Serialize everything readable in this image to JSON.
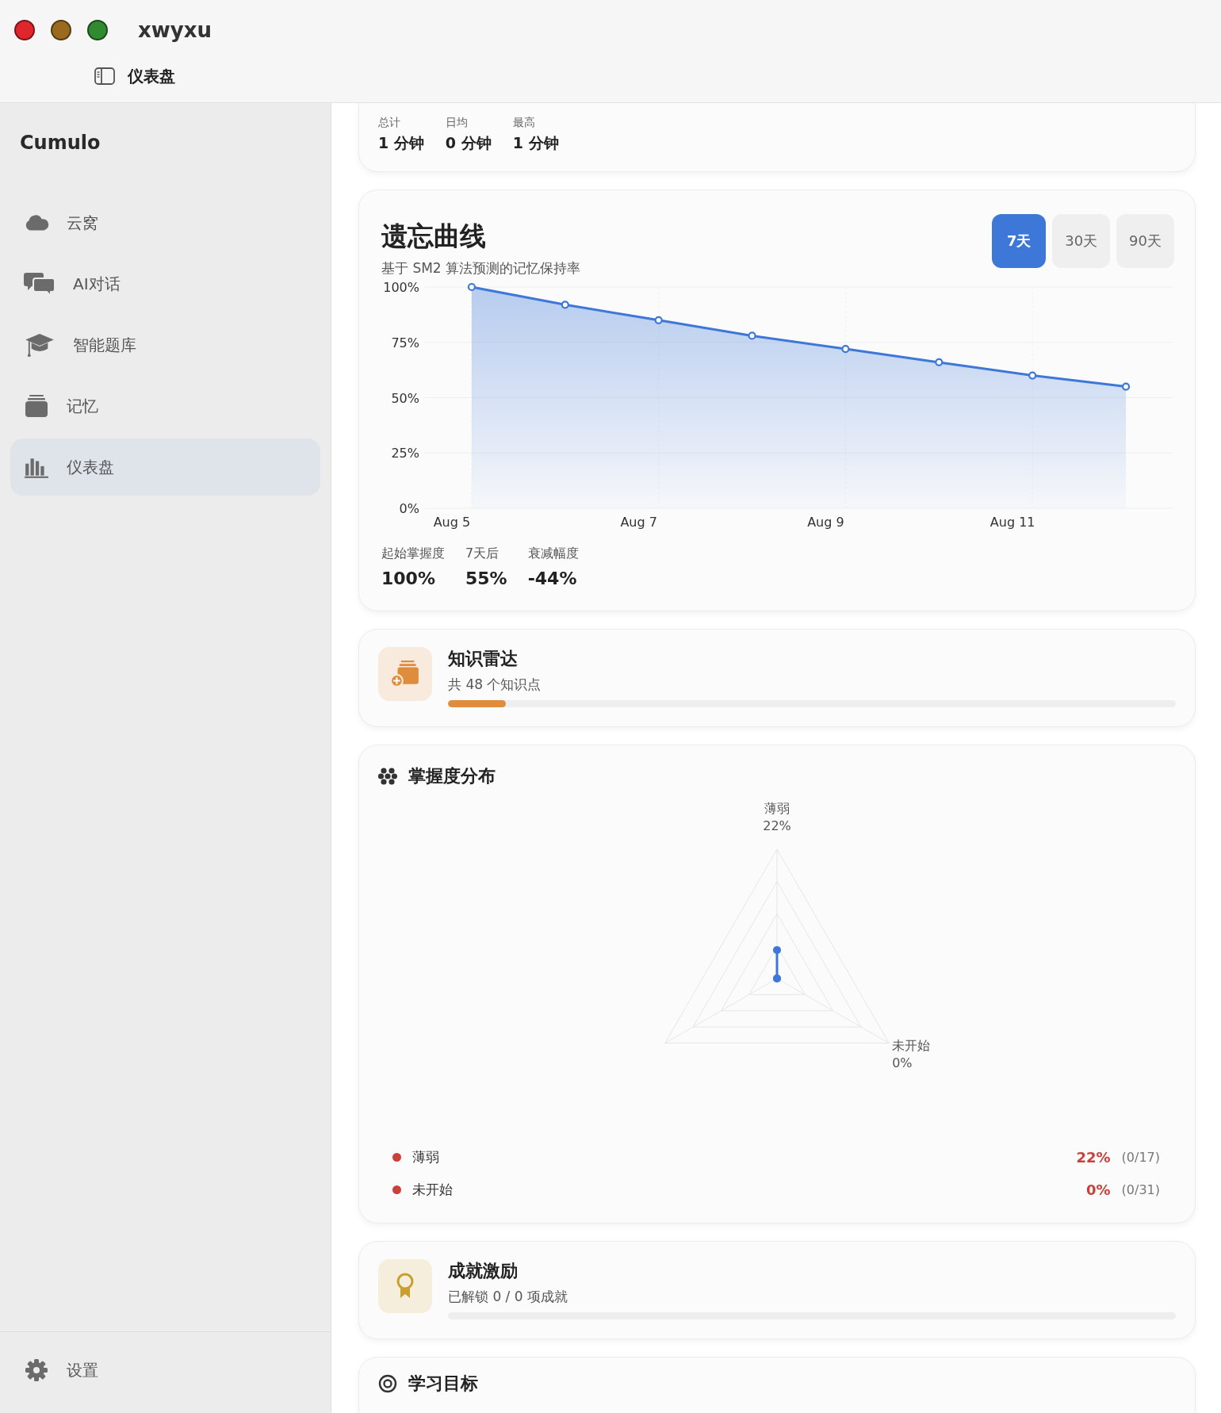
{
  "window": {
    "title": "xwyxu"
  },
  "toolbar": {
    "title": "仪表盘"
  },
  "sidebar": {
    "app_name": "Cumulo",
    "items": [
      {
        "label": "云窝",
        "selected": false
      },
      {
        "label": "AI对话",
        "selected": false
      },
      {
        "label": "智能题库",
        "selected": false
      },
      {
        "label": "记忆",
        "selected": false
      },
      {
        "label": "仪表盘",
        "selected": true
      }
    ],
    "settings": "设置"
  },
  "study_time": {
    "stats": [
      {
        "label": "总计",
        "value": "1 分钟"
      },
      {
        "label": "日均",
        "value": "0 分钟"
      },
      {
        "label": "最高",
        "value": "1 分钟"
      }
    ]
  },
  "forgetting_curve": {
    "title": "遗忘曲线",
    "subtitle": "基于 SM2 算法预测的记忆保持率",
    "ranges": [
      {
        "label": "7天",
        "selected": true
      },
      {
        "label": "30天",
        "selected": false
      },
      {
        "label": "90天",
        "selected": false
      }
    ],
    "chart_data": {
      "type": "area",
      "categories": [
        "Aug 5",
        null,
        "Aug 7",
        null,
        "Aug 9",
        null,
        "Aug 11",
        null
      ],
      "series": [
        {
          "color": "#3d78d8",
          "values": [
            100,
            92,
            85,
            78,
            72,
            66,
            60,
            55
          ]
        }
      ],
      "ylim": [
        0,
        100
      ],
      "grid": true,
      "yticks": [
        {
          "value": 0,
          "label": "0%"
        },
        {
          "value": 25,
          "label": "25%"
        },
        {
          "value": 50,
          "label": "50%"
        },
        {
          "value": 75,
          "label": "75%"
        },
        {
          "value": 100,
          "label": "100%"
        }
      ]
    },
    "stats": [
      {
        "label": "起始掌握度",
        "value": "100%"
      },
      {
        "label": "7天后",
        "value": "55%"
      },
      {
        "label": "衰减幅度",
        "value": "-44%"
      }
    ]
  },
  "knowledge_radar": {
    "title": "知识雷达",
    "subtitle": "共 48 个知识点",
    "level": 0.08
  },
  "mastery": {
    "title": "掌握度分布",
    "axes": [
      {
        "label": "薄弱",
        "value": "22%"
      },
      {
        "label": "未开始",
        "value": "0%"
      }
    ],
    "legend": [
      {
        "name": "薄弱",
        "color": "#c9413a",
        "percent": "22%",
        "count": "(0/17)"
      },
      {
        "name": "未开始",
        "color": "#c9413a",
        "percent": "0%",
        "count": "(0/31)"
      }
    ]
  },
  "achievements": {
    "title": "成就激励",
    "subtitle": "已解锁 0 / 0 项成就",
    "level": 0
  },
  "study_goal": {
    "title": "学习目标"
  }
}
